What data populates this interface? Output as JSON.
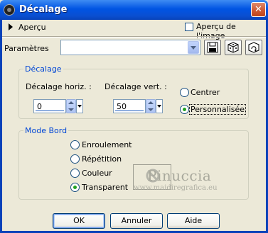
{
  "window": {
    "title": "Décalage",
    "close_glyph": "✕"
  },
  "preview": {
    "label": "Aperçu",
    "image_preview_label": "Aperçu de l'image",
    "image_preview_checked": false
  },
  "parameters": {
    "label": "Paramètres",
    "preset_value": ""
  },
  "offset_group": {
    "legend": "Décalage",
    "horizontal_label": "Décalage horiz. :",
    "horizontal_value": "0",
    "vertical_label": "Décalage vert. :",
    "vertical_value": "50",
    "options": [
      {
        "label": "Centrer",
        "selected": false
      },
      {
        "label": "Personnalisée",
        "selected": true
      }
    ]
  },
  "edge_group": {
    "legend": "Mode Bord",
    "options": [
      {
        "label": "Enroulement",
        "selected": false
      },
      {
        "label": "Répétition",
        "selected": false
      },
      {
        "label": "Couleur",
        "selected": false
      },
      {
        "label": "Transparent",
        "selected": true
      }
    ]
  },
  "watermark": {
    "name": "Pinuccia",
    "url": "www.maidiregrafica.eu"
  },
  "buttons": {
    "ok": "OK",
    "cancel": "Annuler",
    "help": "Aide"
  },
  "colors": {
    "title_bar": "#0054e3",
    "dialog_bg": "#ece9d8",
    "group_legend": "#0046d5",
    "radio_dot": "#21a121"
  }
}
